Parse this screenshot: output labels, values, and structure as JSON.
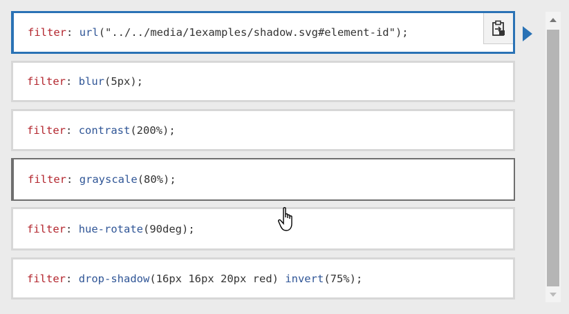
{
  "items": [
    {
      "property": "filter",
      "colon": ":",
      "parts": [
        {
          "t": "url",
          "c": "fn"
        },
        {
          "t": "(\"../../media/1examples/shadow.svg#element-id\");",
          "c": "punc"
        }
      ]
    },
    {
      "property": "filter",
      "colon": ":",
      "parts": [
        {
          "t": "blur",
          "c": "fn"
        },
        {
          "t": "(5px);",
          "c": "punc"
        }
      ]
    },
    {
      "property": "filter",
      "colon": ":",
      "parts": [
        {
          "t": "contrast",
          "c": "fn"
        },
        {
          "t": "(200%);",
          "c": "punc"
        }
      ]
    },
    {
      "property": "filter",
      "colon": ":",
      "parts": [
        {
          "t": "grayscale",
          "c": "fn"
        },
        {
          "t": "(80%);",
          "c": "punc"
        }
      ]
    },
    {
      "property": "filter",
      "colon": ":",
      "parts": [
        {
          "t": "hue-rotate",
          "c": "fn"
        },
        {
          "t": "(90deg);",
          "c": "punc"
        }
      ]
    },
    {
      "property": "filter",
      "colon": ":",
      "parts": [
        {
          "t": "drop-shadow",
          "c": "fn"
        },
        {
          "t": "(16px 16px 20px red) ",
          "c": "punc"
        },
        {
          "t": "invert",
          "c": "fn"
        },
        {
          "t": "(75%);",
          "c": "punc"
        }
      ]
    }
  ],
  "state": {
    "selected_index": 0,
    "hovered_index": 3
  },
  "icons": {
    "copy": "clipboard-icon",
    "pointer": "triangle-right-icon",
    "scroll_up": "chevron-up-icon",
    "scroll_down": "chevron-down-icon",
    "cursor": "hand-pointer-icon"
  },
  "colors": {
    "accent": "#2a72b5",
    "property": "#b3262e",
    "function": "#2f5596",
    "hover_border": "#6e6e6e"
  }
}
